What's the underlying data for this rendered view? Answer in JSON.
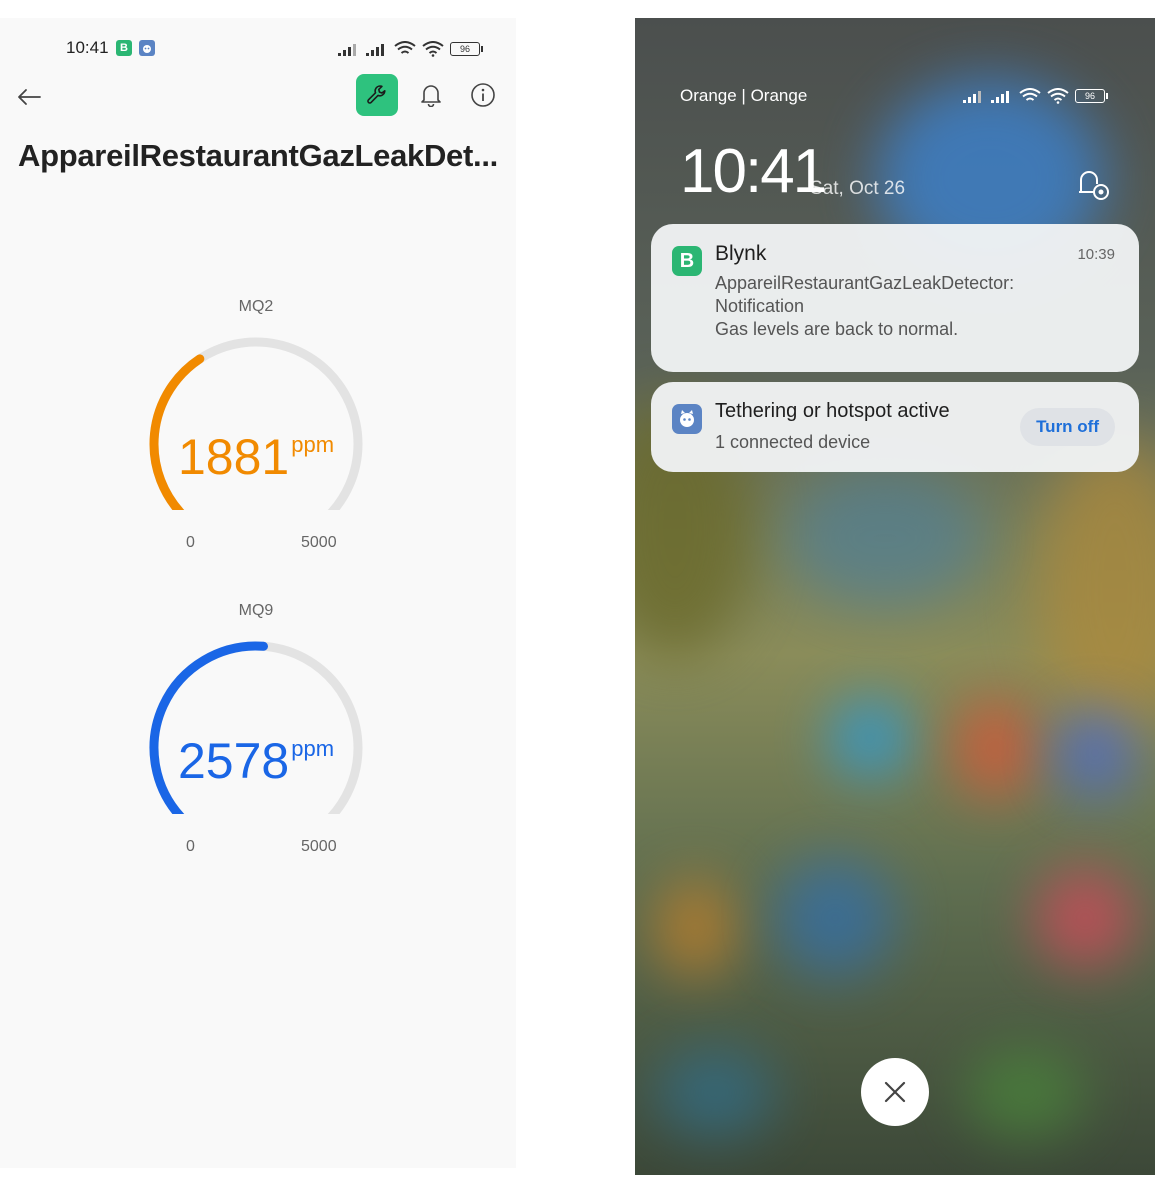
{
  "left_phone": {
    "status_bar": {
      "time": "10:41",
      "app_badges": [
        {
          "letter": "B",
          "color": "#2bb673"
        },
        {
          "letter": "",
          "color": "#5b84c4"
        }
      ],
      "battery": "96"
    },
    "header": {
      "back_icon": "arrow-left-icon",
      "actions": [
        "wrench-icon",
        "bell-icon",
        "info-icon"
      ],
      "accent": "#2ec27e"
    },
    "title": "AppareilRestaurantGazLeakDet...",
    "gauges": [
      {
        "label": "MQ2",
        "value": "1881",
        "unit": "ppm",
        "min": "0",
        "max": "5000",
        "level": 0.3762,
        "color": "#f18a00"
      },
      {
        "label": "MQ9",
        "value": "2578",
        "unit": "ppm",
        "min": "0",
        "max": "5000",
        "level": 0.5156,
        "color": "#1a66e6"
      }
    ]
  },
  "right_phone": {
    "carrier": "Orange | Orange",
    "battery": "96",
    "clock": "10:41",
    "date": "Sat, Oct 26",
    "notifications": [
      {
        "app": "Blynk",
        "time": "10:39",
        "lines": [
          "AppareilRestaurantGazLeakDetector:",
          "Notification",
          "Gas levels are back to normal."
        ],
        "icon_letter": "B",
        "icon_color": "#2bb673"
      },
      {
        "title": "Tethering or hotspot active",
        "subtitle": "1 connected device",
        "action": "Turn off",
        "icon_color": "#5b84c4",
        "action_color": "#1e6fd9"
      }
    ]
  }
}
